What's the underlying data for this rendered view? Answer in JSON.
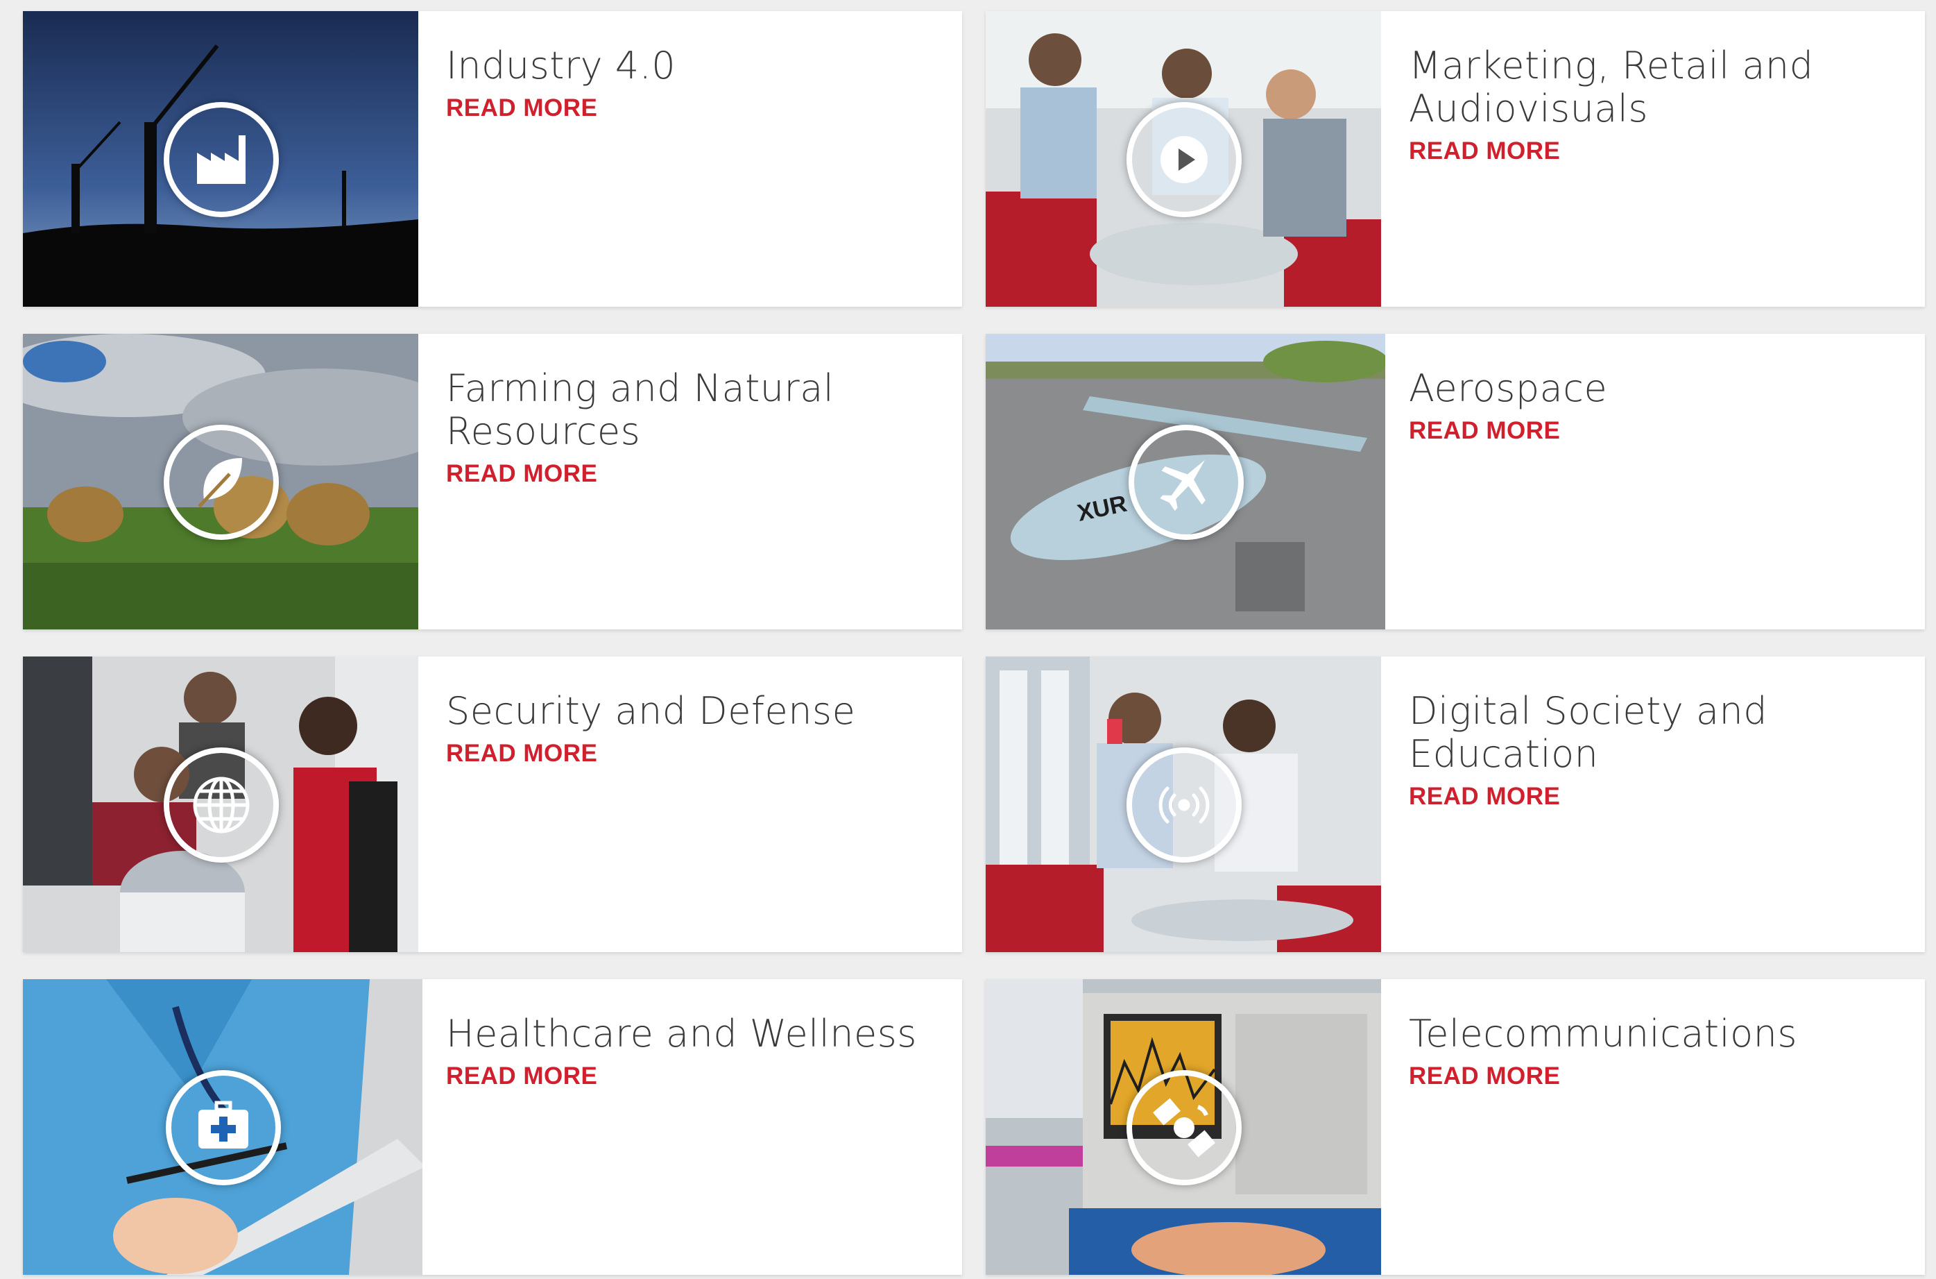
{
  "theme": {
    "accent": "#d0202d",
    "title_color": "#3a3a3a",
    "background": "#eeeeee"
  },
  "cards": [
    {
      "title": "Industry 4.0",
      "link": "READ MORE",
      "icon": "factory-icon"
    },
    {
      "title": "Marketing, Retail and Audiovisuals",
      "link": "READ MORE",
      "icon": "play-icon"
    },
    {
      "title": "Farming and Natural Resources",
      "link": "READ MORE",
      "icon": "leaf-icon"
    },
    {
      "title": "Aerospace",
      "link": "READ MORE",
      "icon": "airplane-icon"
    },
    {
      "title": "Security and Defense",
      "link": "READ MORE",
      "icon": "globe-icon"
    },
    {
      "title": "Digital Society and Education",
      "link": "READ MORE",
      "icon": "broadcast-icon"
    },
    {
      "title": "Healthcare and Wellness",
      "link": "READ MORE",
      "icon": "medical-kit-icon"
    },
    {
      "title": "Telecommunications",
      "link": "READ MORE",
      "icon": "satellite-icon"
    }
  ]
}
